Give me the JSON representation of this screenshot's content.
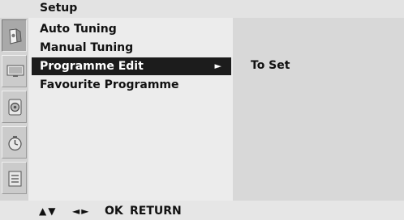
{
  "header": {
    "title": "Setup"
  },
  "rail": {
    "icons": [
      "setup-icon",
      "picture-icon",
      "audio-icon",
      "time-icon",
      "option-icon"
    ],
    "active_index": 0
  },
  "menu": {
    "items": [
      {
        "label": "Auto Tuning"
      },
      {
        "label": "Manual Tuning"
      },
      {
        "label": "Programme Edit",
        "arrow": "►"
      },
      {
        "label": "Favourite Programme"
      }
    ],
    "selected_index": 2
  },
  "submenu": {
    "text": "To Set"
  },
  "footer": {
    "updown": "▲▼",
    "leftright": "◄►",
    "ok": "OK",
    "return": "RETURN"
  },
  "colors": {
    "selected_bg": "#1c1c1c",
    "selected_fg": "#ffffff"
  }
}
